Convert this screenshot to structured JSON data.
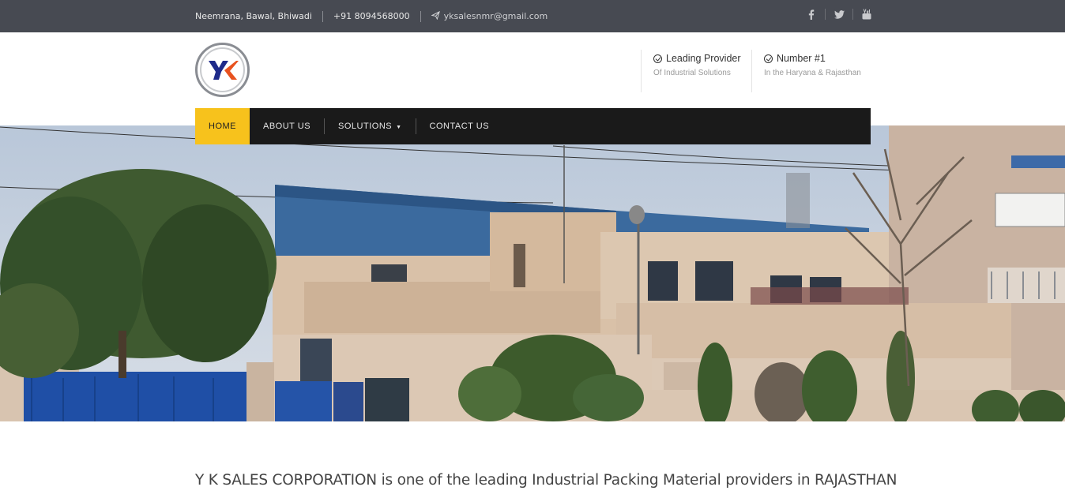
{
  "topbar": {
    "location": "Neemrana, Bawal, Bhiwadi",
    "phone": "+91 8094568000",
    "email": "yksalesnmr@gmail.com",
    "social": [
      {
        "icon": "facebook-icon",
        "glyph": "f"
      },
      {
        "icon": "twitter-icon",
        "glyph": "t"
      },
      {
        "icon": "youtube-icon",
        "glyph": "▶"
      }
    ]
  },
  "header": {
    "logo_text": "YK",
    "features": [
      {
        "title": "Leading Provider",
        "subtitle": "Of Industrial Solutions"
      },
      {
        "title": "Number #1",
        "subtitle": "In the Haryana & Rajasthan"
      }
    ]
  },
  "nav": {
    "items": [
      {
        "label": "HOME",
        "active": true
      },
      {
        "label": "ABOUT US"
      },
      {
        "label": "SOLUTIONS",
        "has_dropdown": true
      },
      {
        "label": "CONTACT US"
      }
    ],
    "active_color": "#f7c21c"
  },
  "hero": {
    "image": "factory-building-photo"
  },
  "intro": {
    "text": "Y K SALES CORPORATION is one of the leading Industrial Packing Material providers in RAJASTHAN"
  }
}
